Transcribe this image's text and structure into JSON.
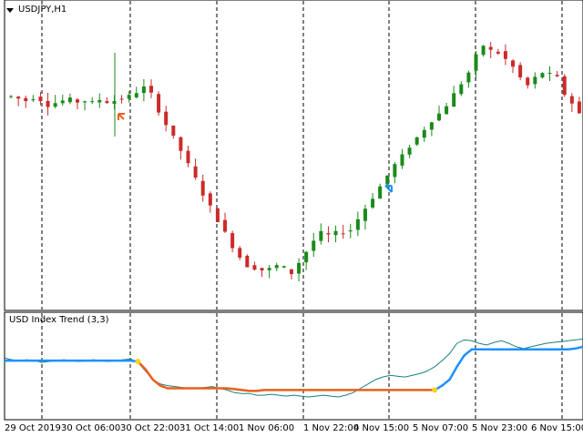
{
  "price_panel": {
    "title": "USDJPY,H1"
  },
  "indicator_panel": {
    "title": "USD Index Trend (3,3)"
  },
  "time_axis": {
    "labels": [
      "29 Oct 2019",
      "30 Oct 06:00",
      "30 Oct 22:00",
      "31 Oct 14:00",
      "1 Nov 06:00",
      "1 Nov 22:00",
      "4 Nov 15:00",
      "5 Nov 07:00",
      "5 Nov 23:00",
      "6 Nov 15:00"
    ]
  },
  "colors": {
    "bull_candle": "#1a8a1a",
    "bear_candle": "#cc2a2a",
    "trend_up": "#1e90ff",
    "trend_down": "#e8601c",
    "index_line": "#1a8080",
    "signal_dot": "#ffd21e",
    "grid": "#000000"
  },
  "chart_data": [
    {
      "type": "candlestick",
      "title": "USDJPY,H1",
      "grid": true,
      "close_path": [
        108.88,
        108.86,
        108.84,
        108.87,
        108.85,
        108.8,
        108.82,
        108.84,
        108.85,
        108.83,
        108.84,
        108.82,
        108.85,
        108.83,
        108.84,
        108.86,
        108.88,
        108.92,
        108.96,
        108.9,
        108.75,
        108.62,
        108.5,
        108.38,
        108.25,
        108.12,
        107.98,
        107.86,
        107.74,
        107.62,
        107.5,
        107.4,
        107.32,
        107.3,
        107.28,
        107.29,
        107.32,
        107.3,
        107.25,
        107.35,
        107.45,
        107.55,
        107.62,
        107.6,
        107.62,
        107.63,
        107.65,
        107.75,
        107.85,
        107.95,
        108.05,
        108.15,
        108.25,
        108.33,
        108.42,
        108.5,
        108.58,
        108.66,
        108.72,
        108.8,
        108.9,
        109.0,
        109.1,
        109.25,
        109.35,
        109.3,
        109.28,
        109.22,
        109.15,
        109.05,
        108.98,
        109.05,
        109.1,
        109.08,
        109.05,
        108.9,
        108.82,
        108.72
      ],
      "annotations": [
        "sell-arrow",
        "buy-arrow"
      ]
    },
    {
      "type": "line",
      "title": "USD Index Trend (3,3)",
      "series": [
        {
          "values": [
            0.62,
            0.62,
            0.62,
            0.62,
            0.62,
            0.62,
            0.62,
            0.62,
            0.62,
            0.62,
            0.62,
            0.62,
            0.62,
            0.62,
            0.62,
            0.62,
            0.62,
            0.62,
            0.61,
            0.52,
            0.4,
            0.33,
            0.3,
            0.3,
            0.3,
            0.3,
            0.3,
            0.3,
            0.3,
            0.3,
            0.3,
            0.29,
            0.28,
            0.27,
            0.27,
            0.28,
            0.28,
            0.28,
            0.28,
            0.28,
            0.28,
            0.28,
            0.28,
            0.28,
            0.28,
            0.28,
            0.28,
            0.28,
            0.28,
            0.28,
            0.28,
            0.28,
            0.28,
            0.28,
            0.28,
            0.28,
            0.28,
            0.28,
            0.28,
            0.33,
            0.4,
            0.55,
            0.68,
            0.75,
            0.75,
            0.75,
            0.75,
            0.75,
            0.75,
            0.75,
            0.75,
            0.75,
            0.75,
            0.75,
            0.75,
            0.75,
            0.75,
            0.76,
            0.78
          ]
        },
        {
          "values": [
            0.65,
            0.63,
            0.62,
            0.63,
            0.62,
            0.6,
            0.61,
            0.62,
            0.63,
            0.62,
            0.61,
            0.62,
            0.63,
            0.62,
            0.61,
            0.62,
            0.63,
            0.64,
            0.6,
            0.5,
            0.4,
            0.35,
            0.33,
            0.32,
            0.31,
            0.3,
            0.3,
            0.31,
            0.32,
            0.3,
            0.28,
            0.25,
            0.24,
            0.24,
            0.22,
            0.22,
            0.23,
            0.22,
            0.21,
            0.22,
            0.21,
            0.2,
            0.21,
            0.22,
            0.21,
            0.2,
            0.22,
            0.25,
            0.3,
            0.35,
            0.4,
            0.43,
            0.45,
            0.44,
            0.43,
            0.45,
            0.47,
            0.5,
            0.55,
            0.62,
            0.7,
            0.82,
            0.86,
            0.85,
            0.82,
            0.8,
            0.83,
            0.85,
            0.82,
            0.78,
            0.76,
            0.78,
            0.8,
            0.82,
            0.83,
            0.84,
            0.85,
            0.86,
            0.87
          ]
        }
      ]
    }
  ]
}
